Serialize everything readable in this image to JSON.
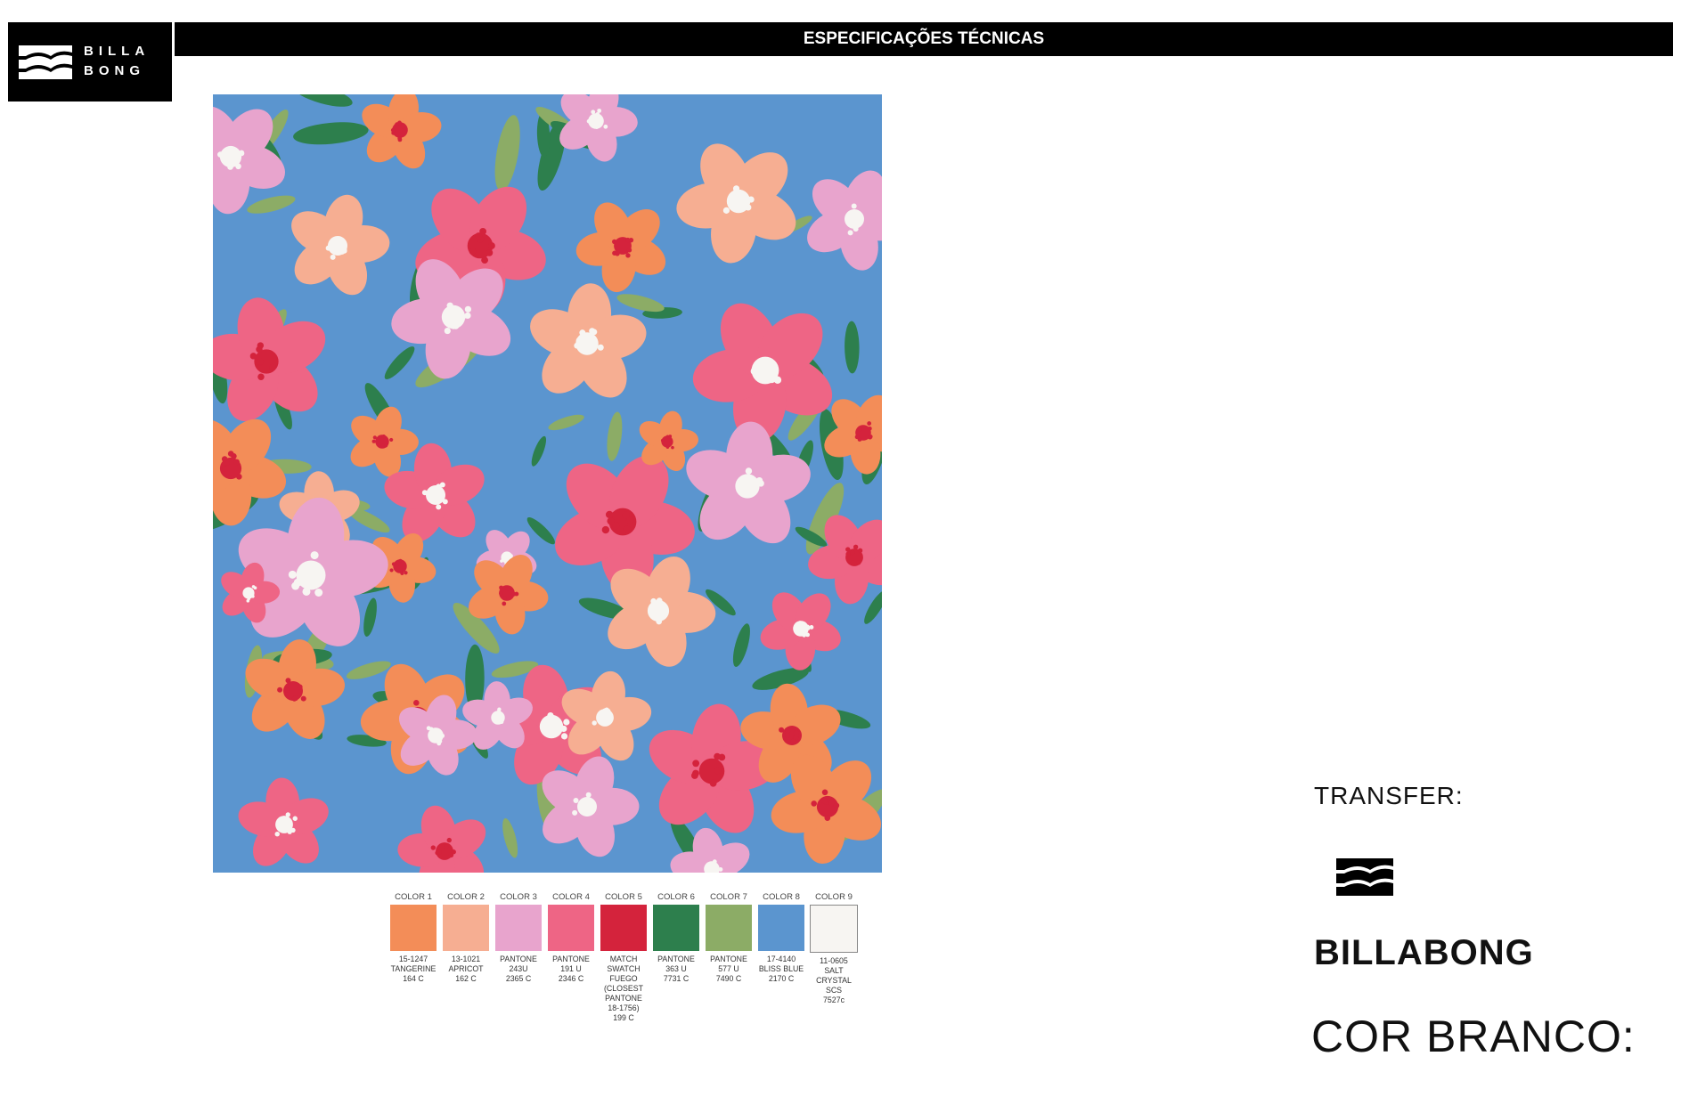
{
  "header": {
    "brand_line_1": "BILLA",
    "brand_line_2": "BONG",
    "title": "ESPECIFICAÇÕES TÉCNICAS"
  },
  "swatches": [
    {
      "label": "COLOR 1",
      "desc": "15-1247\nTANGERINE\n164 C",
      "color": "#f38d58"
    },
    {
      "label": "COLOR 2",
      "desc": "13-1021\nAPRICOT\n162 C",
      "color": "#f6ae92"
    },
    {
      "label": "COLOR 3",
      "desc": "PANTONE\n243U\n2365 C",
      "color": "#e8a4cd"
    },
    {
      "label": "COLOR 4",
      "desc": "PANTONE\n191 U\n2346 C",
      "color": "#ee6585"
    },
    {
      "label": "COLOR 5",
      "desc": "MATCH\nSWATCH\nFUEGO\n(CLOSEST PANTONE\n18-1756)\n199 C",
      "color": "#d4233c"
    },
    {
      "label": "COLOR 6",
      "desc": "PANTONE\n363 U\n7731 C",
      "color": "#2d7f4d"
    },
    {
      "label": "COLOR 7",
      "desc": "PANTONE\n577 U\n7490 C",
      "color": "#8cac66"
    },
    {
      "label": "COLOR 8",
      "desc": "17-4140\nBLISS BLUE\n2170 C",
      "color": "#5b95cf"
    },
    {
      "label": "COLOR 9",
      "desc": "11-0605\nSALT CRYSTAL\nSCS\n7527c",
      "color": "#f7f5f2"
    }
  ],
  "transfer": {
    "label": "TRANSFER:",
    "brand_word": "BILLABONG",
    "color_label": "COR BRANCO:"
  }
}
